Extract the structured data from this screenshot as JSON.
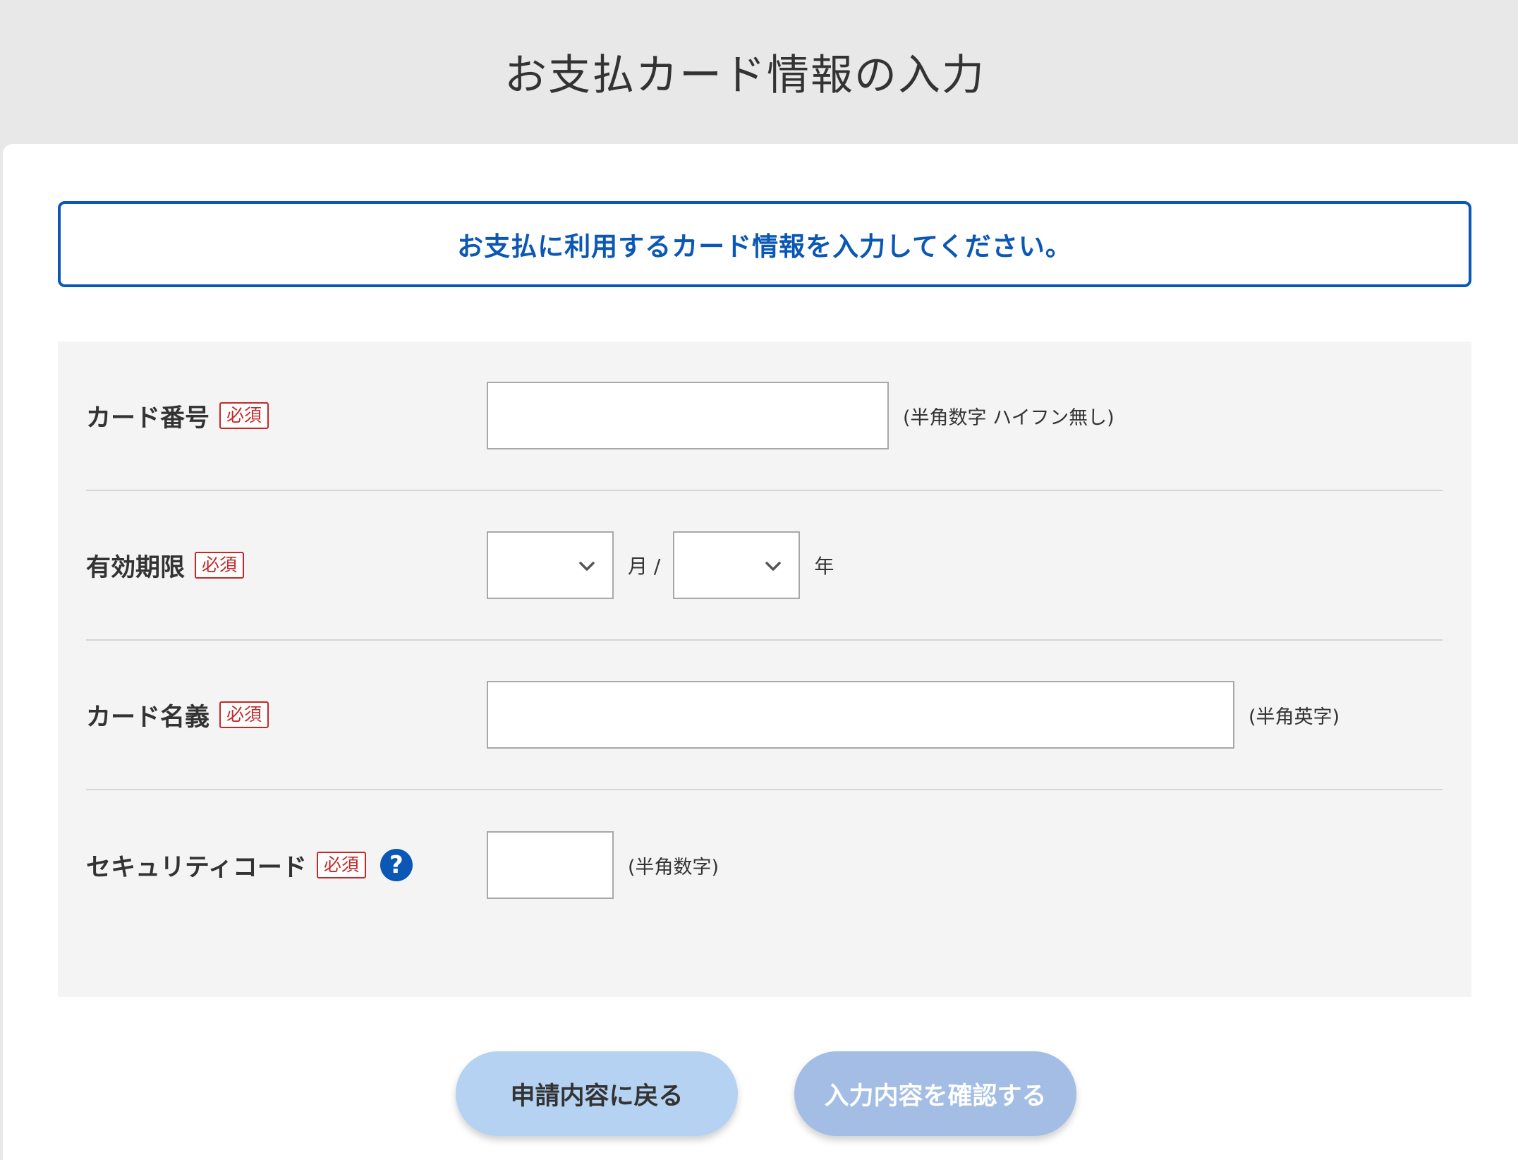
{
  "header": {
    "title": "お支払カード情報の入力"
  },
  "notice": {
    "text": "お支払に利用するカード情報を入力してください。"
  },
  "form": {
    "required_label": "必須",
    "card_number": {
      "label": "カード番号",
      "value": "",
      "hint": "(半角数字 ハイフン無し)"
    },
    "expiry": {
      "label": "有効期限",
      "month_value": "",
      "month_unit": "月 /",
      "year_value": "",
      "year_unit": "年"
    },
    "card_holder": {
      "label": "カード名義",
      "value": "",
      "hint": "(半角英字)"
    },
    "security_code": {
      "label": "セキュリティコード",
      "value": "",
      "hint": "(半角数字)",
      "help_icon": "?"
    }
  },
  "buttons": {
    "back_label": "申請内容に戻る",
    "confirm_label": "入力内容を確認する"
  },
  "colors": {
    "accent": "#0b57b5",
    "required": "#c62828",
    "back_button": "#b5d2f2",
    "confirm_button": "#a3bde5"
  },
  "icons": {
    "select_chevron": "chevron-down-icon",
    "help": "question-circle-icon"
  }
}
